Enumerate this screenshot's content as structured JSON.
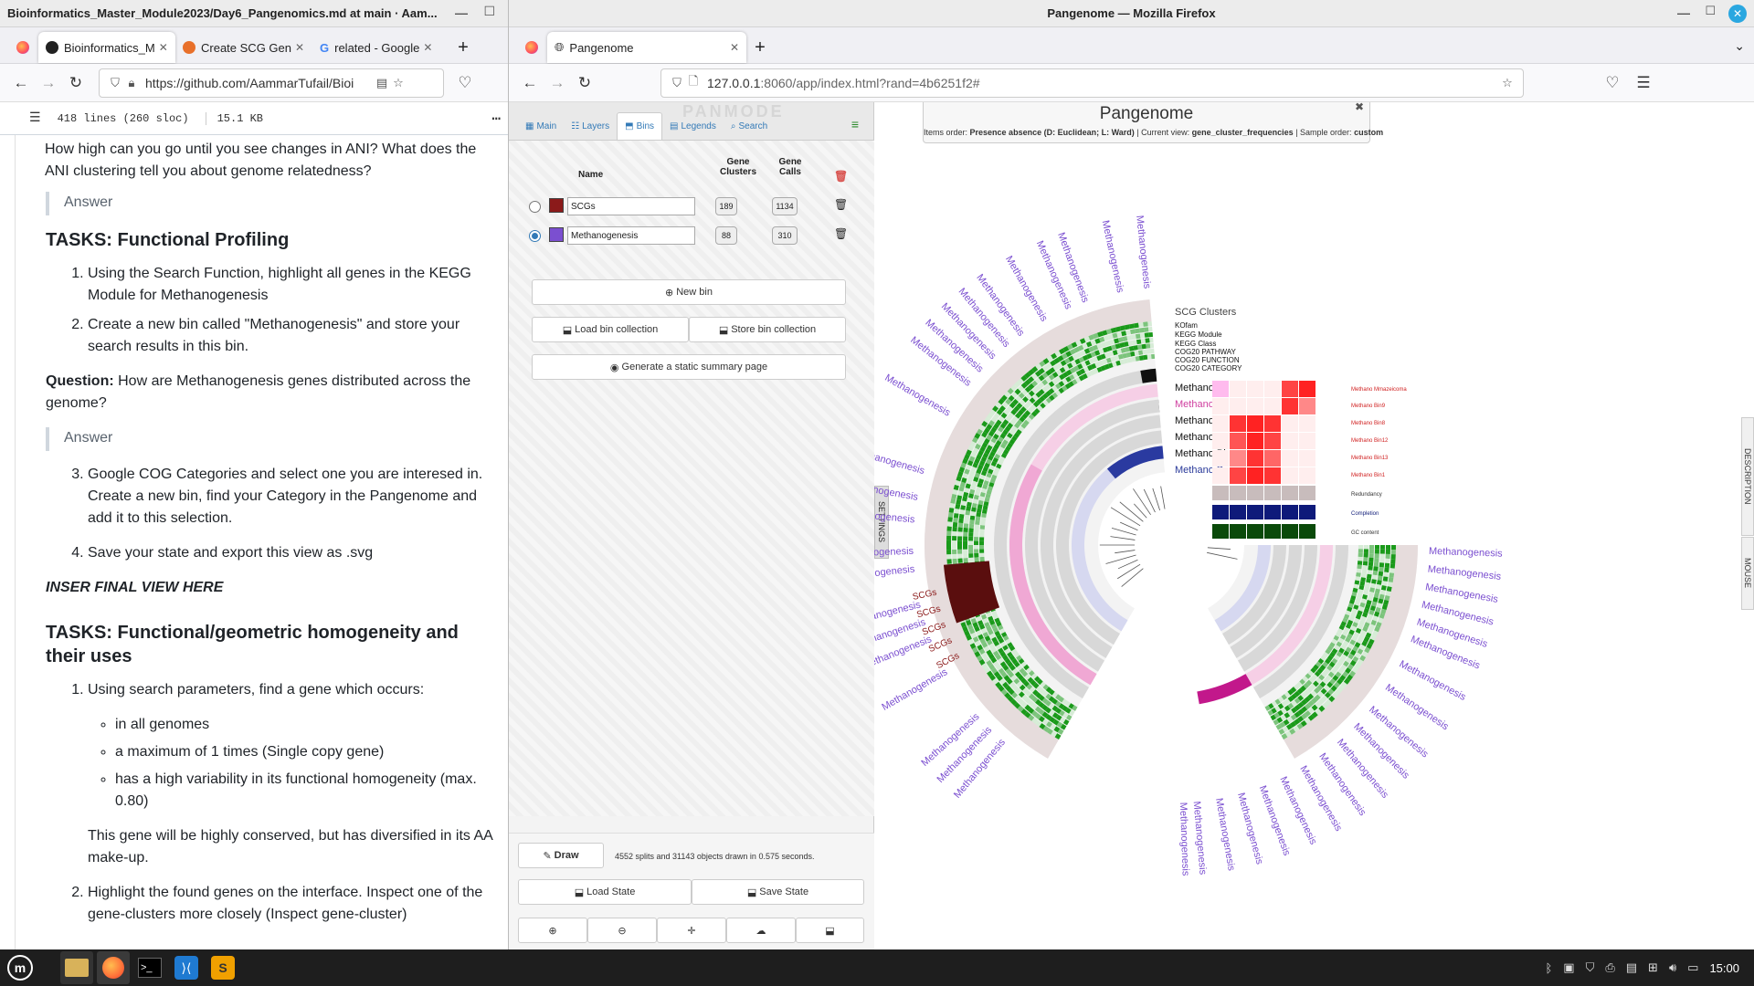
{
  "left_window": {
    "title": "Bioinformatics_Master_Module2023/Day6_Pangenomics.md at main · Aam...",
    "tabs": [
      {
        "label": "Bioinformatics_M",
        "icon": "github-icon"
      },
      {
        "label": "Create SCG Gen",
        "icon": "chatgpt-icon"
      },
      {
        "label": "related - Google",
        "icon": "google-icon"
      }
    ],
    "url": "https://github.com/AammarTufail/Bioi",
    "file_info": {
      "lines": "418 lines (260 sloc)",
      "size": "15.1 KB"
    },
    "content": {
      "question_top": "How high can you go until you see changes in ANI? What does the ANI clustering tell you about genome relatedness?",
      "answer_label": "Answer",
      "heading1": "TASKS: Functional Profiling",
      "task1": "Using the Search Function, highlight all genes in the KEGG Module for Methanogenesis",
      "task2": "Create a new bin called \"Methanogenesis\" and store your search results in this bin.",
      "question_label": "Question:",
      "question2": " How are Methanogenesis genes distributed across the genome?",
      "answer_label2": "Answer",
      "task3": "Google COG Categories and select one you are interesed in. Create a new bin, find your Category in the Pangenome and add it to this selection.",
      "task4": "Save your state and export this view as .svg",
      "insert_final": "INSER FINAL VIEW HERE",
      "heading2": "TASKS: Functional/geometric homogeneity and their uses",
      "task5": "Using search parameters, find a gene which occurs:",
      "sub1": "in all genomes",
      "sub2": "a maximum of 1 times (Single copy gene)",
      "sub3": "has a high variability in its functional homogeneity (max. 0.80)",
      "note": "This gene will be highly conserved, but has diversified in its AA make-up.",
      "task6": "Highlight the found genes on the interface. Inspect one of the gene-clusters more closely (Inspect gene-cluster)"
    }
  },
  "right_window": {
    "title": "Pangenome — Mozilla Firefox",
    "tab": "Pangenome",
    "url_host": "127.0.0.1",
    "url_rest": ":8060/app/index.html?rand=4b6251f2#",
    "panel": {
      "tabs": [
        "Main",
        "Layers",
        "Bins",
        "Legends",
        "Search"
      ],
      "logo": "PANMODE",
      "headers": {
        "name": "Name",
        "clusters": "Gene Clusters",
        "calls": "Gene Calls"
      },
      "bins": [
        {
          "name": "SCGs",
          "clusters": "189",
          "calls": "1134",
          "color": "#8b1a1a"
        },
        {
          "name": "Methanogenesis",
          "clusters": "88",
          "calls": "310",
          "color": "#7b4fd0"
        }
      ],
      "new_bin": "New bin",
      "load_collection": "Load bin collection",
      "store_collection": "Store bin collection",
      "summary": "Generate a static summary page",
      "draw": "Draw",
      "draw_status": "4552 splits and 31143 objects drawn in 0.575 seconds.",
      "load_state": "Load State",
      "save_state": "Save State",
      "settings": "SETTINGS"
    },
    "viewer": {
      "title": "Pangenome",
      "items_order_label": "Items order:",
      "items_order": "Presence absence (D: Euclidean; L: Ward)",
      "current_view_label": "Current view:",
      "current_view": "gene_cluster_frequencies",
      "sample_order_label": "Sample order:",
      "sample_order": "custom",
      "layer_labels": [
        "SCG Clusters",
        "KOfam",
        "KEGG Module",
        "KEGG Class",
        "COG20 PATHWAY",
        "COG20 FUNCTION",
        "COG20 CATEGORY",
        "Methano Mi",
        "Methano Bi",
        "Methano Bi",
        "Methano Bi",
        "Methano Bi",
        "Methano Bi"
      ],
      "heatmap_labels": [
        "Methano Mmazeicoma",
        "Methano Bin9",
        "Methano Bin8",
        "Methano Bin12",
        "Methano Bin13",
        "Methano Bin1",
        "Redundancy",
        "Completion",
        "GC content"
      ],
      "bin_label_scg": "SCGs",
      "bin_label_meth": "Methanogenesis",
      "side_tabs": [
        "DESCRIPTION",
        "MOUSE"
      ]
    }
  },
  "taskbar": {
    "clock": "15:00"
  },
  "colors": {
    "accent": "#337ab7",
    "green": "#1a9a1a",
    "scg": "#6b0f0f",
    "meth": "#7b4fd0",
    "pink": "#e040a0"
  }
}
